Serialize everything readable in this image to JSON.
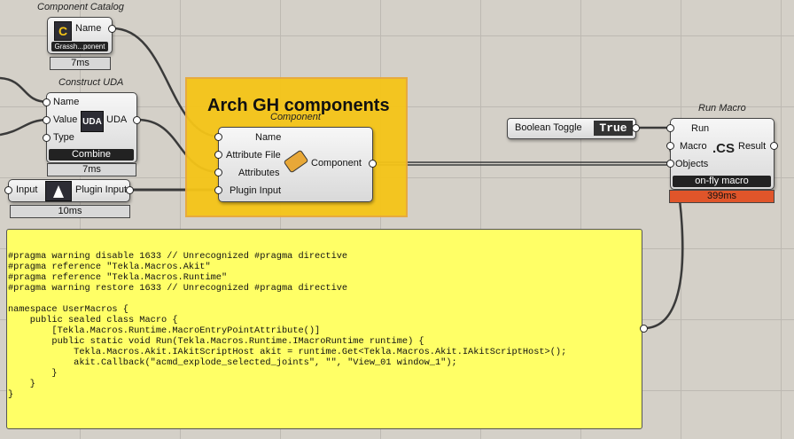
{
  "catalog": {
    "caption": "Component Catalog",
    "icon_letter": "C",
    "output": "Name",
    "footer": "Grassh...ponent",
    "timer": "7ms"
  },
  "construct_uda": {
    "caption": "Construct UDA",
    "inputs": [
      "Name",
      "Value",
      "Type"
    ],
    "icon_text": "UDA",
    "output": "UDA",
    "footer": "Combine",
    "timer": "7ms"
  },
  "plugin_input": {
    "input_label": "Input",
    "output": "Plugin Input",
    "timer": "10ms"
  },
  "group": {
    "title": "Arch GH components",
    "color": "#f5c518"
  },
  "component_node": {
    "caption": "Component",
    "inputs": [
      "Name",
      "Attribute File",
      "Attributes",
      "Plugin Input"
    ],
    "output": "Component"
  },
  "toggle": {
    "label": "Boolean Toggle",
    "value": "True"
  },
  "run_macro": {
    "caption": "Run Macro",
    "inputs": [
      "Run",
      "Macro",
      "Objects"
    ],
    "icon_text": ".CS",
    "output": "Result",
    "footer": "on-fly macro",
    "timer": "399ms",
    "timer_color": "#e0552a"
  },
  "panel": {
    "color": "#ffff66",
    "code": "\n\n#pragma warning disable 1633 // Unrecognized #pragma directive\n#pragma reference \"Tekla.Macros.Akit\"\n#pragma reference \"Tekla.Macros.Runtime\"\n#pragma warning restore 1633 // Unrecognized #pragma directive\n\nnamespace UserMacros {\n    public sealed class Macro {\n        [Tekla.Macros.Runtime.MacroEntryPointAttribute()]\n        public static void Run(Tekla.Macros.Runtime.IMacroRuntime runtime) {\n            Tekla.Macros.Akit.IAkitScriptHost akit = runtime.Get<Tekla.Macros.Akit.IAkitScriptHost>();\n            akit.Callback(\"acmd_explode_selected_joints\", \"\", \"View_01 window_1\");\n        }\n    }\n}"
  }
}
